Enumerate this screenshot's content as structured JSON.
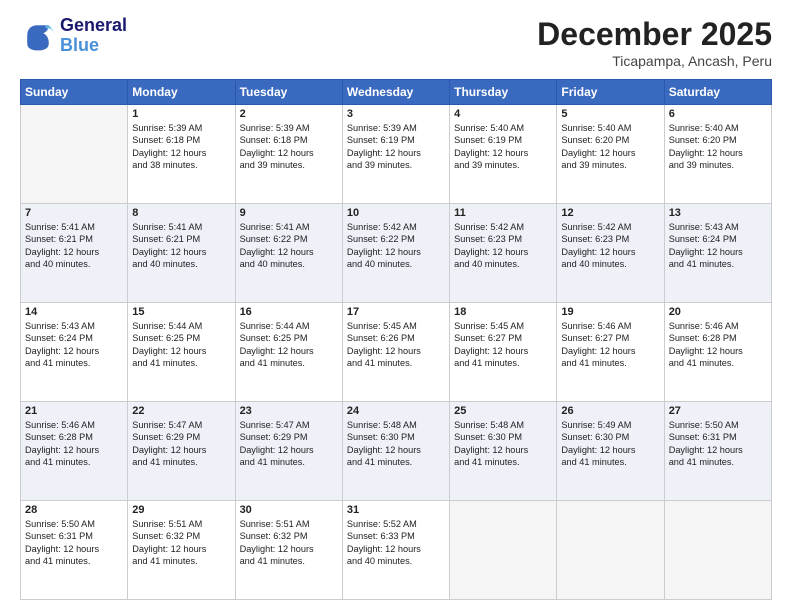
{
  "header": {
    "logo_line1": "General",
    "logo_line2": "Blue",
    "month_year": "December 2025",
    "location": "Ticapampa, Ancash, Peru"
  },
  "days_of_week": [
    "Sunday",
    "Monday",
    "Tuesday",
    "Wednesday",
    "Thursday",
    "Friday",
    "Saturday"
  ],
  "weeks": [
    [
      {
        "day": "",
        "sunrise": "",
        "sunset": "",
        "daylight": "",
        "empty": true
      },
      {
        "day": "1",
        "sunrise": "Sunrise: 5:39 AM",
        "sunset": "Sunset: 6:18 PM",
        "daylight": "Daylight: 12 hours",
        "daylight2": "and 38 minutes."
      },
      {
        "day": "2",
        "sunrise": "Sunrise: 5:39 AM",
        "sunset": "Sunset: 6:18 PM",
        "daylight": "Daylight: 12 hours",
        "daylight2": "and 39 minutes."
      },
      {
        "day": "3",
        "sunrise": "Sunrise: 5:39 AM",
        "sunset": "Sunset: 6:19 PM",
        "daylight": "Daylight: 12 hours",
        "daylight2": "and 39 minutes."
      },
      {
        "day": "4",
        "sunrise": "Sunrise: 5:40 AM",
        "sunset": "Sunset: 6:19 PM",
        "daylight": "Daylight: 12 hours",
        "daylight2": "and 39 minutes."
      },
      {
        "day": "5",
        "sunrise": "Sunrise: 5:40 AM",
        "sunset": "Sunset: 6:20 PM",
        "daylight": "Daylight: 12 hours",
        "daylight2": "and 39 minutes."
      },
      {
        "day": "6",
        "sunrise": "Sunrise: 5:40 AM",
        "sunset": "Sunset: 6:20 PM",
        "daylight": "Daylight: 12 hours",
        "daylight2": "and 39 minutes."
      }
    ],
    [
      {
        "day": "7",
        "sunrise": "Sunrise: 5:41 AM",
        "sunset": "Sunset: 6:21 PM",
        "daylight": "Daylight: 12 hours",
        "daylight2": "and 40 minutes."
      },
      {
        "day": "8",
        "sunrise": "Sunrise: 5:41 AM",
        "sunset": "Sunset: 6:21 PM",
        "daylight": "Daylight: 12 hours",
        "daylight2": "and 40 minutes."
      },
      {
        "day": "9",
        "sunrise": "Sunrise: 5:41 AM",
        "sunset": "Sunset: 6:22 PM",
        "daylight": "Daylight: 12 hours",
        "daylight2": "and 40 minutes."
      },
      {
        "day": "10",
        "sunrise": "Sunrise: 5:42 AM",
        "sunset": "Sunset: 6:22 PM",
        "daylight": "Daylight: 12 hours",
        "daylight2": "and 40 minutes."
      },
      {
        "day": "11",
        "sunrise": "Sunrise: 5:42 AM",
        "sunset": "Sunset: 6:23 PM",
        "daylight": "Daylight: 12 hours",
        "daylight2": "and 40 minutes."
      },
      {
        "day": "12",
        "sunrise": "Sunrise: 5:42 AM",
        "sunset": "Sunset: 6:23 PM",
        "daylight": "Daylight: 12 hours",
        "daylight2": "and 40 minutes."
      },
      {
        "day": "13",
        "sunrise": "Sunrise: 5:43 AM",
        "sunset": "Sunset: 6:24 PM",
        "daylight": "Daylight: 12 hours",
        "daylight2": "and 41 minutes."
      }
    ],
    [
      {
        "day": "14",
        "sunrise": "Sunrise: 5:43 AM",
        "sunset": "Sunset: 6:24 PM",
        "daylight": "Daylight: 12 hours",
        "daylight2": "and 41 minutes."
      },
      {
        "day": "15",
        "sunrise": "Sunrise: 5:44 AM",
        "sunset": "Sunset: 6:25 PM",
        "daylight": "Daylight: 12 hours",
        "daylight2": "and 41 minutes."
      },
      {
        "day": "16",
        "sunrise": "Sunrise: 5:44 AM",
        "sunset": "Sunset: 6:25 PM",
        "daylight": "Daylight: 12 hours",
        "daylight2": "and 41 minutes."
      },
      {
        "day": "17",
        "sunrise": "Sunrise: 5:45 AM",
        "sunset": "Sunset: 6:26 PM",
        "daylight": "Daylight: 12 hours",
        "daylight2": "and 41 minutes."
      },
      {
        "day": "18",
        "sunrise": "Sunrise: 5:45 AM",
        "sunset": "Sunset: 6:27 PM",
        "daylight": "Daylight: 12 hours",
        "daylight2": "and 41 minutes."
      },
      {
        "day": "19",
        "sunrise": "Sunrise: 5:46 AM",
        "sunset": "Sunset: 6:27 PM",
        "daylight": "Daylight: 12 hours",
        "daylight2": "and 41 minutes."
      },
      {
        "day": "20",
        "sunrise": "Sunrise: 5:46 AM",
        "sunset": "Sunset: 6:28 PM",
        "daylight": "Daylight: 12 hours",
        "daylight2": "and 41 minutes."
      }
    ],
    [
      {
        "day": "21",
        "sunrise": "Sunrise: 5:46 AM",
        "sunset": "Sunset: 6:28 PM",
        "daylight": "Daylight: 12 hours",
        "daylight2": "and 41 minutes."
      },
      {
        "day": "22",
        "sunrise": "Sunrise: 5:47 AM",
        "sunset": "Sunset: 6:29 PM",
        "daylight": "Daylight: 12 hours",
        "daylight2": "and 41 minutes."
      },
      {
        "day": "23",
        "sunrise": "Sunrise: 5:47 AM",
        "sunset": "Sunset: 6:29 PM",
        "daylight": "Daylight: 12 hours",
        "daylight2": "and 41 minutes."
      },
      {
        "day": "24",
        "sunrise": "Sunrise: 5:48 AM",
        "sunset": "Sunset: 6:30 PM",
        "daylight": "Daylight: 12 hours",
        "daylight2": "and 41 minutes."
      },
      {
        "day": "25",
        "sunrise": "Sunrise: 5:48 AM",
        "sunset": "Sunset: 6:30 PM",
        "daylight": "Daylight: 12 hours",
        "daylight2": "and 41 minutes."
      },
      {
        "day": "26",
        "sunrise": "Sunrise: 5:49 AM",
        "sunset": "Sunset: 6:30 PM",
        "daylight": "Daylight: 12 hours",
        "daylight2": "and 41 minutes."
      },
      {
        "day": "27",
        "sunrise": "Sunrise: 5:50 AM",
        "sunset": "Sunset: 6:31 PM",
        "daylight": "Daylight: 12 hours",
        "daylight2": "and 41 minutes."
      }
    ],
    [
      {
        "day": "28",
        "sunrise": "Sunrise: 5:50 AM",
        "sunset": "Sunset: 6:31 PM",
        "daylight": "Daylight: 12 hours",
        "daylight2": "and 41 minutes."
      },
      {
        "day": "29",
        "sunrise": "Sunrise: 5:51 AM",
        "sunset": "Sunset: 6:32 PM",
        "daylight": "Daylight: 12 hours",
        "daylight2": "and 41 minutes."
      },
      {
        "day": "30",
        "sunrise": "Sunrise: 5:51 AM",
        "sunset": "Sunset: 6:32 PM",
        "daylight": "Daylight: 12 hours",
        "daylight2": "and 41 minutes."
      },
      {
        "day": "31",
        "sunrise": "Sunrise: 5:52 AM",
        "sunset": "Sunset: 6:33 PM",
        "daylight": "Daylight: 12 hours",
        "daylight2": "and 40 minutes."
      },
      {
        "day": "",
        "sunrise": "",
        "sunset": "",
        "daylight": "",
        "daylight2": "",
        "empty": true
      },
      {
        "day": "",
        "sunrise": "",
        "sunset": "",
        "daylight": "",
        "daylight2": "",
        "empty": true
      },
      {
        "day": "",
        "sunrise": "",
        "sunset": "",
        "daylight": "",
        "daylight2": "",
        "empty": true
      }
    ]
  ]
}
